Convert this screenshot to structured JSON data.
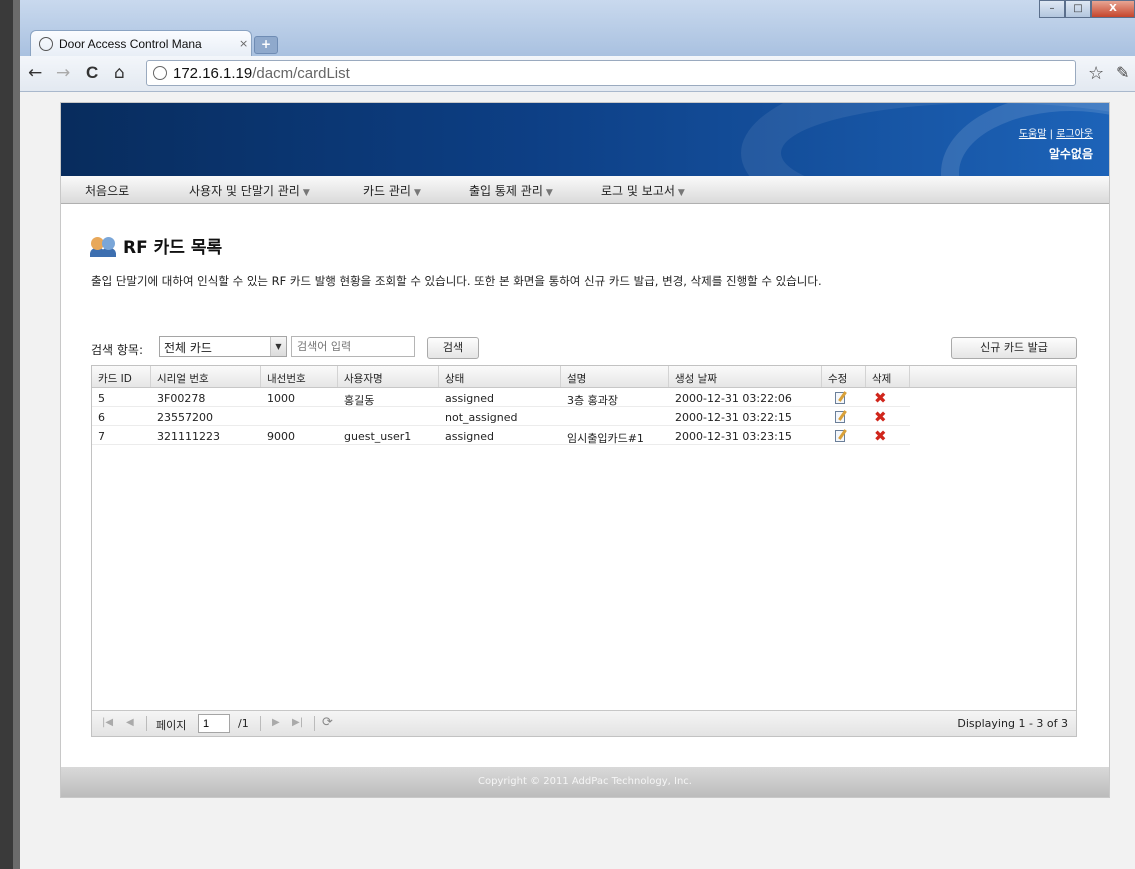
{
  "browser": {
    "tab_title": "Door Access Control Mana",
    "tab_close": "×",
    "new_tab": "+",
    "window_buttons": {
      "minimize": "–",
      "maximize": "□",
      "close": "X"
    },
    "url_host": "172.16.1.19",
    "url_path": "/dacm/cardList",
    "nav": {
      "back": "←",
      "forward": "→",
      "reload": "C",
      "home": "⌂",
      "star": "☆",
      "wrench": "🔧"
    }
  },
  "header": {
    "help_link": "도움말",
    "separator": "|",
    "logout_link": "로그아웃",
    "user_name": "알수없음"
  },
  "menu": [
    {
      "label": "처음으로",
      "dropdown": false
    },
    {
      "label": "사용자 및 단말기 관리",
      "dropdown": true
    },
    {
      "label": "카드 관리",
      "dropdown": true
    },
    {
      "label": "출입 통제 관리",
      "dropdown": true
    },
    {
      "label": "로그 및 보고서",
      "dropdown": true
    }
  ],
  "caret": "▼",
  "page": {
    "title": "RF 카드 목록",
    "description": "출입 단말기에 대하여 인식할 수 있는 RF 카드 발행 현황을 조회할 수 있습니다. 또한 본 화면을 통하여 신규 카드 발급, 변경, 삭제를 진행할 수 있습니다."
  },
  "search": {
    "label": "검색 항목:",
    "selected": "전체 카드",
    "placeholder": "검색어 입력",
    "button": "검색",
    "issue_button": "신규 카드 발급"
  },
  "table": {
    "columns": [
      "카드 ID",
      "시리얼 번호",
      "내선번호",
      "사용자명",
      "상태",
      "설명",
      "생성 날짜",
      "수정",
      "삭제"
    ],
    "rows": [
      {
        "id": "5",
        "serial": "3F00278",
        "ext": "1000",
        "user": "홍길동",
        "status": "assigned",
        "desc": "3층 홍과장",
        "created": "2000-12-31 03:22:06"
      },
      {
        "id": "6",
        "serial": "23557200",
        "ext": "",
        "user": "",
        "status": "not_assigned",
        "desc": "",
        "created": "2000-12-31 03:22:15"
      },
      {
        "id": "7",
        "serial": "321111223",
        "ext": "9000",
        "user": "guest_user1",
        "status": "assigned",
        "desc": "임시출입카드#1",
        "created": "2000-12-31 03:23:15"
      }
    ],
    "delete_icon": "✖"
  },
  "pager": {
    "first": "|◀",
    "prev": "◀",
    "page_label": "페이지",
    "page_value": "1",
    "total": "/1",
    "next": "▶",
    "last": "▶|",
    "refresh": "⟳",
    "displaying": "Displaying 1 - 3 of 3"
  },
  "footer": {
    "copyright": "Copyright © 2011 AddPac Technology, Inc."
  }
}
